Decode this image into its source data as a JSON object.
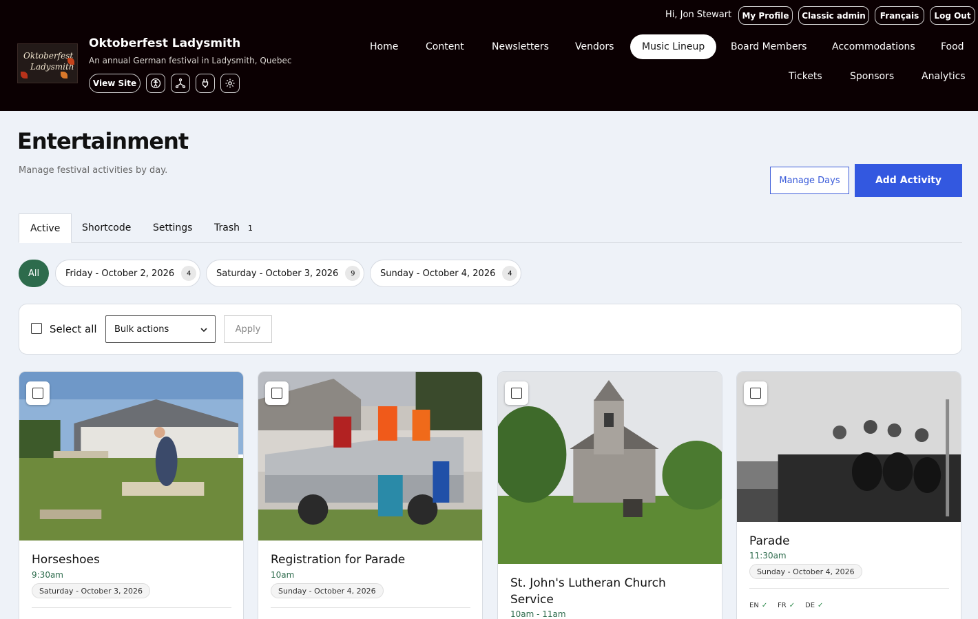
{
  "header": {
    "site_title": "Oktoberfest Ladysmith",
    "site_subtitle": "An annual German festival in Ladysmith, Quebec",
    "logo_text_1": "Oktoberfest",
    "logo_text_2": "Ladysmith",
    "view_site": "View Site",
    "greeting": "Hi, Jon Stewart",
    "top_links": [
      "My Profile",
      "Classic admin",
      "Français",
      "Log Out"
    ],
    "nav": {
      "home": "Home",
      "content": "Content",
      "newsletters": "Newsletters",
      "vendors": "Vendors",
      "music_lineup": "Music Lineup",
      "board_members": "Board Members",
      "accommodations": "Accommodations",
      "food": "Food",
      "tickets": "Tickets",
      "sponsors": "Sponsors",
      "analytics": "Analytics"
    },
    "icons": [
      "accessibility-icon",
      "sitemap-icon",
      "plugin-icon",
      "gear-icon"
    ]
  },
  "page": {
    "title": "Entertainment",
    "subtitle": "Manage festival activities by day.",
    "manage_days": "Manage Days",
    "add_activity": "Add Activity"
  },
  "tabs": {
    "active": "Active",
    "shortcode": "Shortcode",
    "settings": "Settings",
    "trash": "Trash",
    "trash_count": "1"
  },
  "days": {
    "all": "All",
    "items": [
      {
        "label": "Friday - October 2, 2026",
        "count": "4"
      },
      {
        "label": "Saturday - October 3, 2026",
        "count": "9"
      },
      {
        "label": "Sunday - October 4, 2026",
        "count": "4"
      }
    ]
  },
  "bulk": {
    "select_all": "Select all",
    "bulk_actions": "Bulk actions",
    "apply": "Apply"
  },
  "cards": [
    {
      "title": "Horseshoes",
      "time": "9:30am",
      "day": "Saturday - October 3, 2026"
    },
    {
      "title": "Registration for Parade",
      "time": "10am",
      "day": "Sunday - October 4, 2026"
    },
    {
      "title": "St. John's Lutheran Church Service",
      "time": "10am - 11am",
      "day": ""
    },
    {
      "title": "Parade",
      "time": "11:30am",
      "day": "Sunday - October 4, 2026",
      "langs": [
        "EN",
        "FR",
        "DE"
      ]
    }
  ],
  "colors": {
    "header_bg": "#0b0002",
    "accent_blue": "#3358e0",
    "accent_green": "#2d6b4c",
    "page_bg": "#eef2f8"
  }
}
